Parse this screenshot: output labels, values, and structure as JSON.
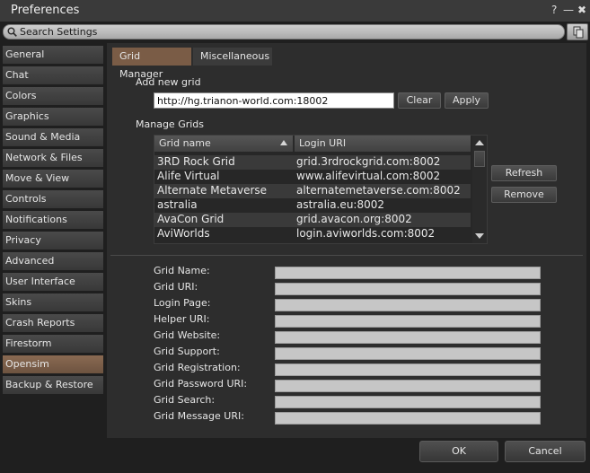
{
  "window": {
    "title": "Preferences",
    "help_label": "?",
    "minimize_label": "—",
    "close_label": "✖"
  },
  "search": {
    "placeholder": "Search Settings",
    "value": ""
  },
  "sidebar": {
    "items": [
      {
        "label": "General"
      },
      {
        "label": "Chat"
      },
      {
        "label": "Colors"
      },
      {
        "label": "Graphics"
      },
      {
        "label": "Sound & Media"
      },
      {
        "label": "Network & Files"
      },
      {
        "label": "Move & View"
      },
      {
        "label": "Controls"
      },
      {
        "label": "Notifications"
      },
      {
        "label": "Privacy"
      },
      {
        "label": "Advanced"
      },
      {
        "label": "User Interface"
      },
      {
        "label": "Skins"
      },
      {
        "label": "Crash Reports"
      },
      {
        "label": "Firestorm"
      },
      {
        "label": "Opensim"
      },
      {
        "label": "Backup & Restore"
      }
    ],
    "active": "Opensim"
  },
  "tabs": [
    {
      "label": "Grid Manager"
    },
    {
      "label": "Miscellaneous"
    }
  ],
  "add_grid": {
    "label": "Add new grid",
    "value": "http://hg.trianon-world.com:18002",
    "clear_label": "Clear",
    "apply_label": "Apply"
  },
  "manage": {
    "label": "Manage Grids",
    "columns": [
      "Grid name",
      "Login URI"
    ],
    "rows": [
      {
        "name": "3RD Rock Grid",
        "uri": "grid.3rdrockgrid.com:8002"
      },
      {
        "name": "Alife Virtual",
        "uri": "www.alifevirtual.com:8002"
      },
      {
        "name": "Alternate Metaverse",
        "uri": "alternatemetaverse.com:8002"
      },
      {
        "name": "astralia",
        "uri": "astralia.eu:8002"
      },
      {
        "name": "AvaCon Grid",
        "uri": "grid.avacon.org:8002"
      },
      {
        "name": "AviWorlds",
        "uri": "login.aviworlds.com:8002"
      }
    ],
    "refresh_label": "Refresh",
    "remove_label": "Remove"
  },
  "fields": [
    {
      "label": "Grid Name:"
    },
    {
      "label": "Grid URI:"
    },
    {
      "label": "Login Page:"
    },
    {
      "label": "Helper URI:"
    },
    {
      "label": "Grid Website:"
    },
    {
      "label": "Grid Support:"
    },
    {
      "label": "Grid Registration:"
    },
    {
      "label": "Grid Password URI:"
    },
    {
      "label": "Grid Search:"
    },
    {
      "label": "Grid Message URI:"
    }
  ],
  "footer": {
    "ok_label": "OK",
    "cancel_label": "Cancel"
  }
}
